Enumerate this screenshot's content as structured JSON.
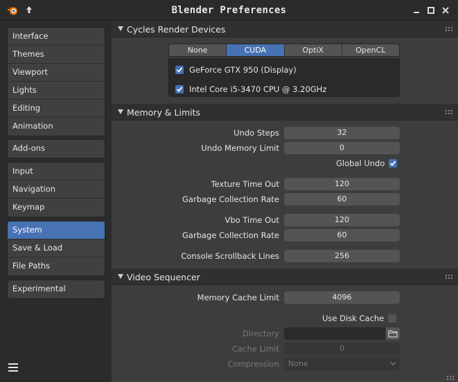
{
  "window": {
    "title": "Blender Preferences"
  },
  "sidebar": {
    "groups": [
      [
        "Interface",
        "Themes",
        "Viewport",
        "Lights",
        "Editing",
        "Animation"
      ],
      [
        "Add-ons"
      ],
      [
        "Input",
        "Navigation",
        "Keymap"
      ],
      [
        "System",
        "Save & Load",
        "File Paths"
      ],
      [
        "Experimental"
      ]
    ],
    "active": "System"
  },
  "cycles": {
    "header": "Cycles Render Devices",
    "tabs": [
      "None",
      "CUDA",
      "OptiX",
      "OpenCL"
    ],
    "active_tab": "CUDA",
    "devices": [
      {
        "label": "GeForce GTX 950 (Display)",
        "checked": true
      },
      {
        "label": "Intel Core i5-3470 CPU @ 3.20GHz",
        "checked": true
      }
    ]
  },
  "memory": {
    "header": "Memory & Limits",
    "undo_steps_label": "Undo Steps",
    "undo_steps": "32",
    "undo_memory_label": "Undo Memory Limit",
    "undo_memory": "0",
    "global_undo_label": "Global Undo",
    "global_undo": true,
    "texture_timeout_label": "Texture Time Out",
    "texture_timeout": "120",
    "gc_rate_label_1": "Garbage Collection Rate",
    "gc_rate_1": "60",
    "vbo_timeout_label": "Vbo Time Out",
    "vbo_timeout": "120",
    "gc_rate_label_2": "Garbage Collection Rate",
    "gc_rate_2": "60",
    "console_label": "Console Scrollback Lines",
    "console_lines": "256"
  },
  "video": {
    "header": "Video Sequencer",
    "cache_limit_label": "Memory Cache Limit",
    "cache_limit": "4096",
    "use_disk_cache_label": "Use Disk Cache",
    "use_disk_cache": false,
    "directory_label": "Directory",
    "directory": "",
    "disk_cache_limit_label": "Cache Limit",
    "disk_cache_limit": "0",
    "compression_label": "Compression",
    "compression": "None"
  },
  "icons": {
    "logo": "blender-logo-icon",
    "up": "arrow-up-icon",
    "minimize": "minimize-icon",
    "maximize": "maximize-icon",
    "close": "close-icon",
    "menu": "hamburger-menu-icon",
    "folder": "folder-icon"
  },
  "colors": {
    "accent": "#4772b3",
    "panel": "#3d3d3d",
    "sidebar": "#2b2b2b",
    "field": "#545454"
  }
}
